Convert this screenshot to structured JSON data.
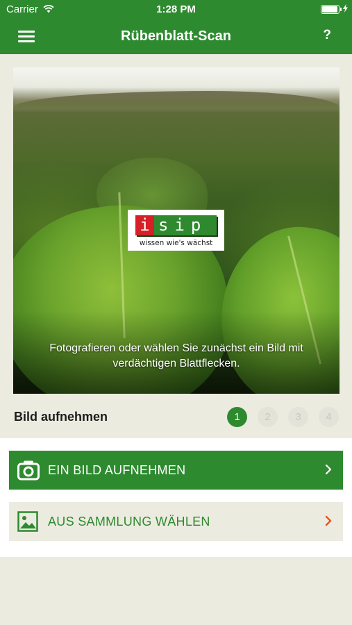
{
  "status_bar": {
    "carrier": "Carrier",
    "time": "1:28 PM",
    "battery_level": 1.0,
    "wifi_icon": "wifi-icon",
    "charging_icon": "bolt-icon"
  },
  "nav": {
    "title": "Rübenblatt-Scan",
    "menu_icon": "hamburger-menu-icon",
    "help_label": "?"
  },
  "hero": {
    "logo": {
      "letter": "i",
      "rest": "sip",
      "tagline": "wissen wie's wächst"
    },
    "caption": "Fotografieren oder wählen Sie zunächst ein Bild mit verdächtigen Blattflecken."
  },
  "step_section": {
    "label": "Bild aufnehmen",
    "steps": [
      "1",
      "2",
      "3",
      "4"
    ],
    "active_step": 1
  },
  "actions": {
    "take_photo": {
      "label": "EIN BILD AUFNEHMEN",
      "icon": "camera-icon"
    },
    "choose_gallery": {
      "label": "AUS SAMMLUNG WÄHLEN",
      "icon": "image-icon"
    }
  },
  "colors": {
    "brand_green": "#2d8a2f",
    "background": "#ecebe0",
    "accent_orange": "#e8541c",
    "logo_red": "#d61f26"
  }
}
